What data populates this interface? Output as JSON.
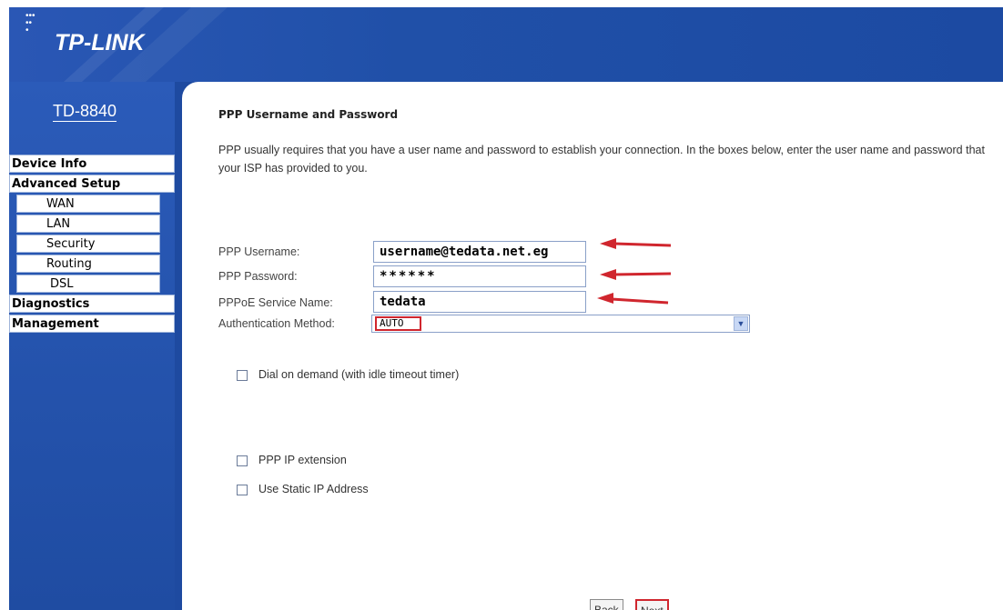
{
  "header": {
    "logo": "TP-LINK",
    "model": "TD-8840"
  },
  "sidebar": {
    "items": [
      {
        "label": "Device Info"
      },
      {
        "label": "Advanced Setup"
      },
      {
        "label": "WAN"
      },
      {
        "label": "LAN"
      },
      {
        "label": "Security"
      },
      {
        "label": "Routing"
      },
      {
        "label": "DSL"
      },
      {
        "label": "Diagnostics"
      },
      {
        "label": "Management"
      }
    ]
  },
  "page": {
    "title": "PPP Username and Password",
    "description": "PPP usually requires that you have a user name and password to establish your connection. In the boxes below, enter the user name and password that your ISP has provided to you."
  },
  "form": {
    "username_label": "PPP Username:",
    "username_value": "username@tedata.net.eg",
    "password_label": "PPP Password:",
    "password_value": "******",
    "service_label": "PPPoE Service Name:",
    "service_value": "tedata",
    "auth_label": "Authentication Method:",
    "auth_value": "AUTO",
    "dial_on_demand": "Dial on demand (with idle timeout timer)",
    "ppp_ip_extension": "PPP IP extension",
    "static_ip": "Use Static IP Address"
  },
  "buttons": {
    "back": "Back",
    "next": "Next"
  },
  "colors": {
    "brand_blue": "#1e4aa0",
    "annotation_red": "#d0262e"
  },
  "icons": {
    "annotation_arrow": "red-arrow-icon",
    "dropdown": "chevron-down-icon"
  }
}
